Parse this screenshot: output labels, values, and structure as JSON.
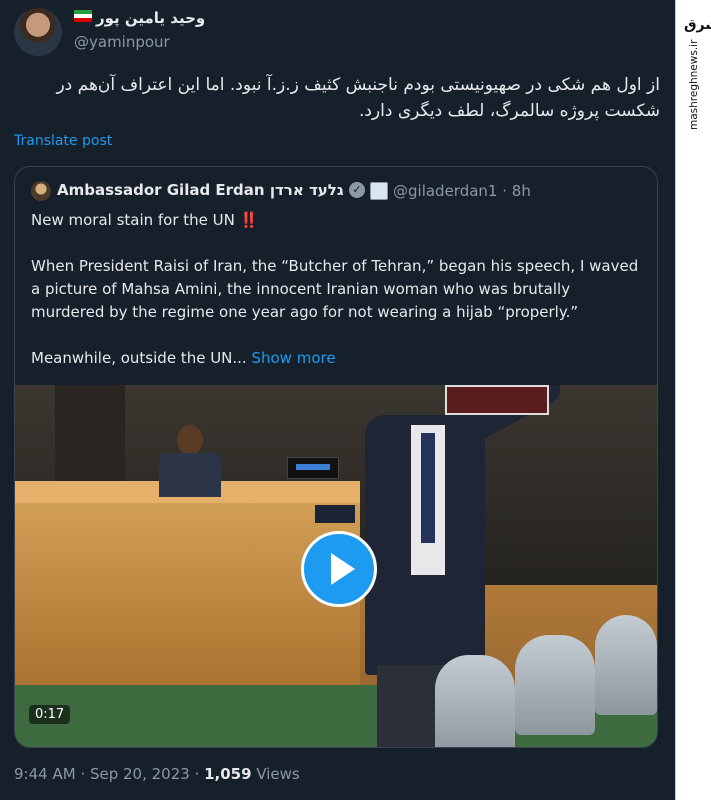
{
  "sidebar": {
    "logo": "مشرق",
    "site": "mashreghnews.ir"
  },
  "post": {
    "author_name": "وحید یامین پور",
    "author_handle": "@yaminpour",
    "text": "از اول هم شکی در صهیونیستی بودم ناجنبش کثیف ز.ز.آ نبود. اما این اعتراف آن‌هم در شکست پروژه سالمرگ، لطف دیگری دارد.",
    "translate_label": "Translate post",
    "time": "9:44 AM · Sep 20, 2023 · ",
    "views_count": "1,059",
    "views_label": " Views"
  },
  "quote": {
    "author_name": "Ambassador Gilad Erdan גלעד ארדן",
    "handle_time": "@giladerdan1 · 8h",
    "first_line": "New moral stain for the UN ",
    "first_line_emoji": "‼️",
    "paragraph": "When President Raisi of Iran, the “Butcher of Tehran,” began his speech, I waved a picture of Mahsa Amini, the innocent Iranian woman who was brutally murdered by the regime one year ago for not wearing a hijab “properly.”",
    "last_line": "Meanwhile, outside the UN... ",
    "show_more": "Show more"
  },
  "video": {
    "duration": "0:17",
    "play_icon": "play-icon"
  },
  "colors": {
    "background": "#15202b",
    "accent": "#1d9bf0",
    "muted": "#8b98a5",
    "text": "#e7e9ea"
  }
}
